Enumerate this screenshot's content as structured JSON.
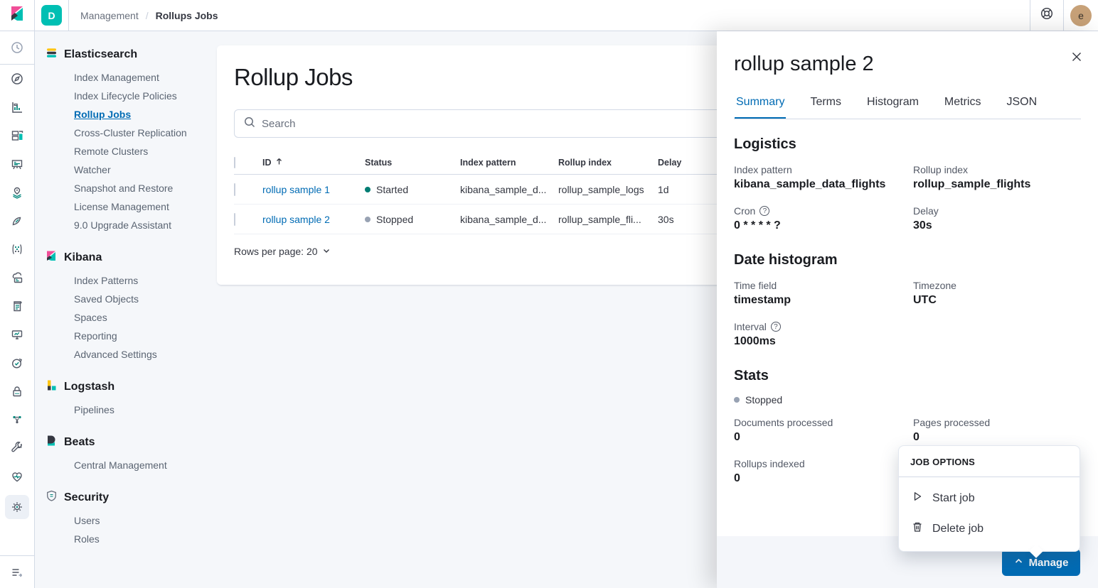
{
  "topbar": {
    "breadcrumbs": {
      "parent": "Management",
      "current": "Rollups Jobs"
    },
    "space_initial": "D",
    "user_initial": "e"
  },
  "sidebar": {
    "sections": [
      {
        "title": "Elasticsearch",
        "items": [
          "Index Management",
          "Index Lifecycle Policies",
          "Rollup Jobs",
          "Cross-Cluster Replication",
          "Remote Clusters",
          "Watcher",
          "Snapshot and Restore",
          "License Management",
          "9.0 Upgrade Assistant"
        ],
        "active_item": "Rollup Jobs"
      },
      {
        "title": "Kibana",
        "items": [
          "Index Patterns",
          "Saved Objects",
          "Spaces",
          "Reporting",
          "Advanced Settings"
        ]
      },
      {
        "title": "Logstash",
        "items": [
          "Pipelines"
        ]
      },
      {
        "title": "Beats",
        "items": [
          "Central Management"
        ]
      },
      {
        "title": "Security",
        "items": [
          "Users",
          "Roles"
        ]
      }
    ]
  },
  "main": {
    "title": "Rollup Jobs",
    "search_placeholder": "Search",
    "table": {
      "headers": [
        "ID",
        "Status",
        "Index pattern",
        "Rollup index",
        "Delay"
      ],
      "rows": [
        {
          "id": "rollup sample 1",
          "status": "Started",
          "index_pattern": "kibana_sample_d...",
          "rollup_index": "rollup_sample_logs",
          "delay": "1d"
        },
        {
          "id": "rollup sample 2",
          "status": "Stopped",
          "index_pattern": "kibana_sample_d...",
          "rollup_index": "rollup_sample_fli...",
          "delay": "30s"
        }
      ]
    },
    "rows_per_page": "Rows per page: 20"
  },
  "flyout": {
    "title": "rollup sample 2",
    "tabs": [
      "Summary",
      "Terms",
      "Histogram",
      "Metrics",
      "JSON"
    ],
    "active_tab": "Summary",
    "logistics": {
      "heading": "Logistics",
      "fields": [
        {
          "label": "Index pattern",
          "value": "kibana_sample_data_flights"
        },
        {
          "label": "Rollup index",
          "value": "rollup_sample_flights"
        },
        {
          "label": "Cron",
          "value": "0 * * * * ?"
        },
        {
          "label": "Delay",
          "value": "30s"
        }
      ]
    },
    "date_histogram": {
      "heading": "Date histogram",
      "fields": [
        {
          "label": "Time field",
          "value": "timestamp"
        },
        {
          "label": "Timezone",
          "value": "UTC"
        },
        {
          "label": "Interval",
          "value": "1000ms"
        }
      ]
    },
    "stats": {
      "heading": "Stats",
      "status": "Stopped",
      "fields": [
        {
          "label": "Documents processed",
          "value": "0"
        },
        {
          "label": "Pages processed",
          "value": "0"
        },
        {
          "label": "Rollups indexed",
          "value": "0"
        }
      ]
    },
    "manage_button": "Manage"
  },
  "job_options_popup": {
    "title": "JOB OPTIONS",
    "items": [
      {
        "label": "Start job",
        "icon": "play-icon"
      },
      {
        "label": "Delete job",
        "icon": "trash-icon"
      }
    ]
  },
  "icons": {
    "rail": [
      "recent-clock-icon",
      "discover-compass-icon",
      "visualize-chart-icon",
      "dashboard-panels-icon",
      "canvas-frame-icon",
      "maps-pin-icon",
      "ml-icon",
      "graph-icon",
      "apm-icon",
      "logs-icon",
      "metrics-icon",
      "uptime-icon",
      "siem-lock-icon",
      "ingest-nodes-icon",
      "devtools-wrench-icon",
      "monitoring-heartbeat-icon",
      "management-gear-icon",
      "collapse-nav-icon"
    ],
    "help": "life-buoy-icon"
  },
  "colors": {
    "accent": "#006bb4",
    "teal": "#00bfb3",
    "pink": "#f04e98",
    "yellow": "#fec514",
    "dark": "#343741",
    "started_dot": "#017d73",
    "stopped_dot": "#98a2b3",
    "page_bg": "#f5f7fa",
    "border": "#d3dae6",
    "user_avatar_bg": "#c7a178"
  }
}
